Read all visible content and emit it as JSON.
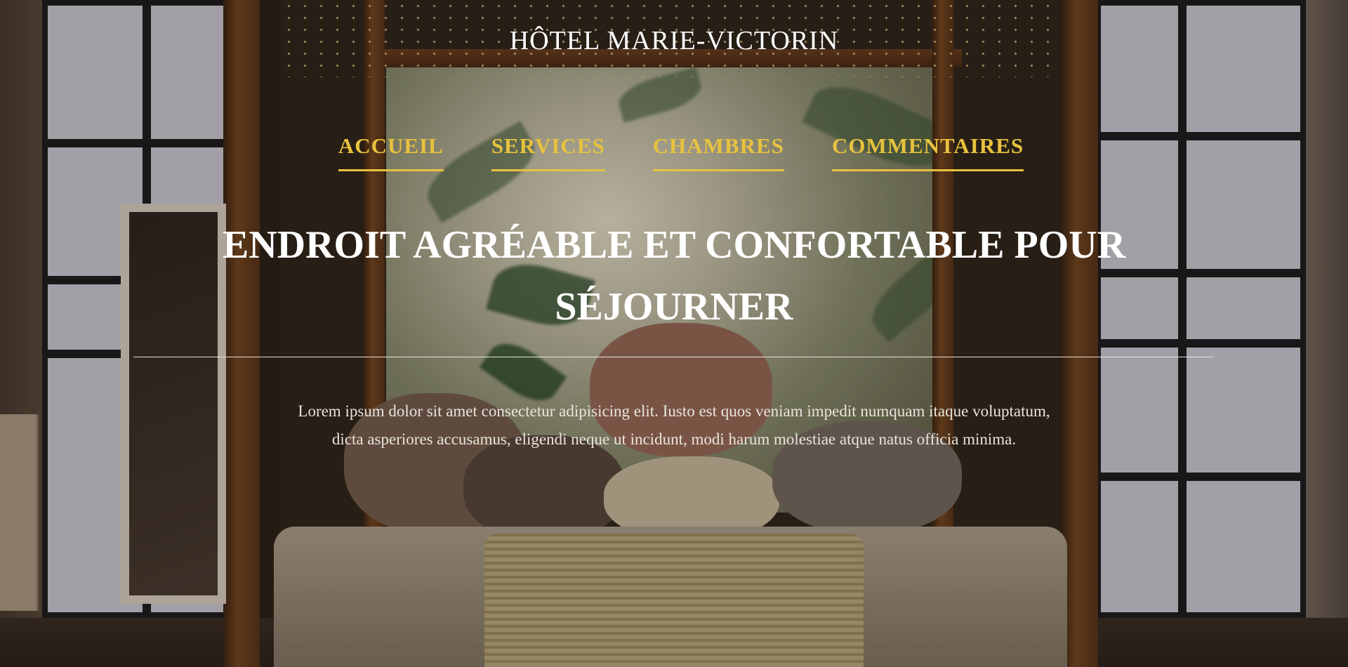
{
  "site": {
    "title": "HÔTEL MARIE-VICTORIN"
  },
  "nav": {
    "items": [
      {
        "label": "ACCUEIL"
      },
      {
        "label": "SERVICES"
      },
      {
        "label": "CHAMBRES"
      },
      {
        "label": "COMMENTAIRES"
      }
    ],
    "color": "#e8c23e"
  },
  "hero": {
    "headline": "ENDROIT AGRÉABLE ET CONFORTABLE POUR SÉJOURNER",
    "text": "Lorem ipsum dolor sit amet consectetur adipisicing elit. Iusto est quos veniam impedit numquam itaque voluptatum, dicta asperiores accusamus, eligendi neque ut incidunt, modi harum molestiae atque natus officia minima."
  }
}
